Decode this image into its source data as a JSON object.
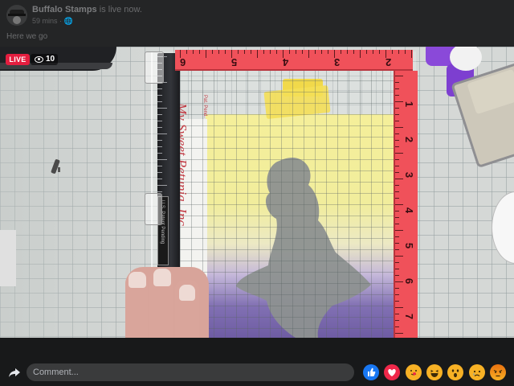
{
  "post": {
    "page_name": "Buffalo Stamps",
    "status_text": " is live now.",
    "meta": "59 mins · ",
    "caption": "Here we go"
  },
  "live": {
    "badge": "LIVE",
    "viewers": "10"
  },
  "video": {
    "ruler_numbers_top": [
      "6",
      "5",
      "4",
      "3",
      "2"
    ],
    "ruler_numbers_right": [
      "1",
      "2",
      "3",
      "4",
      "5",
      "6",
      "7"
    ],
    "brand_text": "My Sweet Petunia, Inc.",
    "brand_sub": "Pat. Pend.",
    "spine_label": "U.S. Patent Pending"
  },
  "footer": {
    "comment_placeholder": "Comment..."
  },
  "reactions": [
    "like",
    "love",
    "care",
    "haha",
    "wow",
    "sad",
    "angry"
  ],
  "colors": {
    "live_red": "#e41e3f",
    "like_blue": "#1877f2",
    "love_red": "#f0284a",
    "emoji_yellow": "#f7b125",
    "ruler_pink": "#f0515a"
  }
}
